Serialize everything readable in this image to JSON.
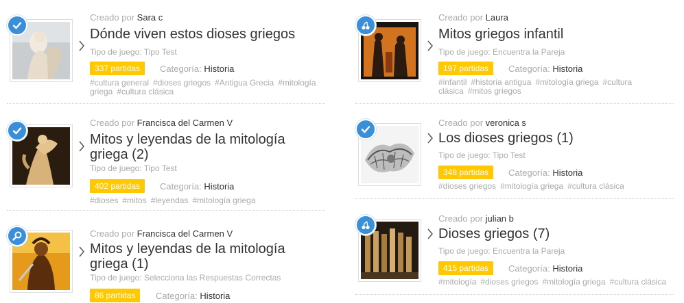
{
  "labels": {
    "creado_por": "Creado por",
    "tipo_prefix": "Tipo de juego:",
    "categoria": "Categoría:"
  },
  "colors": {
    "accent_blue": "#3a8fd8",
    "partidas_yellow": "#ffc800"
  },
  "cards": [
    {
      "badge": "check-icon",
      "creator": "Sara c",
      "title": "Dónde viven estos dioses griegos",
      "tipo": "Tipo Test",
      "partidas": "337 partidas",
      "categoria": "Historia",
      "tags": [
        "#cultura general",
        "#dioses griegos",
        "#Antigua Grecia",
        "#mitología griega",
        "#cultura clásica"
      ]
    },
    {
      "badge": "cherries-icon",
      "creator": "Laura",
      "title": "Mitos griegos infantil",
      "tipo": "Encuentra la Pareja",
      "partidas": "197 partidas",
      "categoria": "Historia",
      "tags": [
        "#infantil",
        "#historia antigua",
        "#mitología griega",
        "#cultura clásica",
        "#mitos griegos"
      ]
    },
    {
      "badge": "check-icon",
      "creator": "Francisca del Carmen V",
      "title": "Mitos y leyendas de la mitología griega (2)",
      "tipo": "Tipo Test",
      "partidas": "402 partidas",
      "categoria": "Historia",
      "tags": [
        "#dioses",
        "#mitos",
        "#leyendas",
        "#mitología griega"
      ]
    },
    {
      "badge": "check-icon",
      "creator": "veronica s",
      "title": "Los dioses griegos (1)",
      "tipo": "Tipo Test",
      "partidas": "348 partidas",
      "categoria": "Historia",
      "tags": [
        "#dioses griegos",
        "#mitología griega",
        "#cultura clásica"
      ]
    },
    {
      "badge": "magnifier-icon",
      "creator": "Francisca del Carmen V",
      "title": "Mitos y leyendas de la mitología griega (1)",
      "tipo": "Selecciona las Respuestas Correctas",
      "partidas": "86 partidas",
      "categoria": "Historia",
      "tags": []
    },
    {
      "badge": "cherries-icon",
      "creator": "julian b",
      "title": "Dioses griegos (7)",
      "tipo": "Encuentra la Pareja",
      "partidas": "415 partidas",
      "categoria": "Historia",
      "tags": [
        "#mitología",
        "#dioses griegos",
        "#mitología griega",
        "#cultura clásica"
      ]
    }
  ]
}
